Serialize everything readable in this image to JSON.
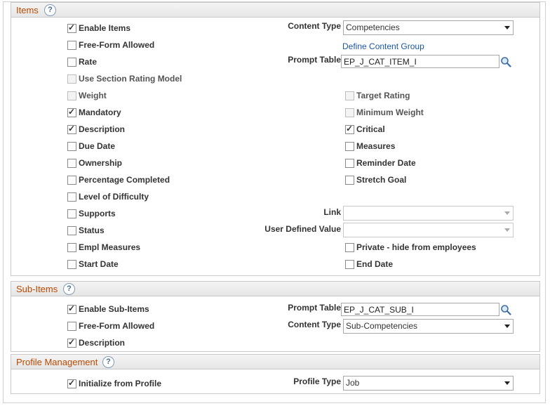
{
  "items": {
    "title": "Items",
    "help": "?",
    "left_checkboxes": [
      {
        "label": "Enable Items",
        "checked": true,
        "disabled": false
      },
      {
        "label": "Free-Form Allowed",
        "checked": false,
        "disabled": false
      },
      {
        "label": "Rate",
        "checked": false,
        "disabled": false
      },
      {
        "label": "Use Section Rating Model",
        "checked": false,
        "disabled": true
      },
      {
        "label": "Weight",
        "checked": false,
        "disabled": true
      },
      {
        "label": "Mandatory",
        "checked": true,
        "disabled": false
      },
      {
        "label": "Description",
        "checked": true,
        "disabled": false
      },
      {
        "label": "Due Date",
        "checked": false,
        "disabled": false
      },
      {
        "label": "Ownership",
        "checked": false,
        "disabled": false
      },
      {
        "label": "Percentage Completed",
        "checked": false,
        "disabled": false
      },
      {
        "label": "Level of Difficulty",
        "checked": false,
        "disabled": false
      },
      {
        "label": "Supports",
        "checked": false,
        "disabled": false
      },
      {
        "label": "Status",
        "checked": false,
        "disabled": false
      },
      {
        "label": "Empl Measures",
        "checked": false,
        "disabled": false
      },
      {
        "label": "Start Date",
        "checked": false,
        "disabled": false
      }
    ],
    "right_checkboxes": [
      {
        "label": "Target Rating",
        "checked": false,
        "disabled": true
      },
      {
        "label": "Minimum Weight",
        "checked": false,
        "disabled": true
      },
      {
        "label": "Critical",
        "checked": true,
        "disabled": false
      },
      {
        "label": "Measures",
        "checked": false,
        "disabled": false
      },
      {
        "label": "Reminder Date",
        "checked": false,
        "disabled": false
      },
      {
        "label": "Stretch Goal",
        "checked": false,
        "disabled": false
      },
      {
        "label": "Private - hide from employees",
        "checked": false,
        "disabled": false
      },
      {
        "label": "End Date",
        "checked": false,
        "disabled": false
      }
    ],
    "content_type_label": "Content Type",
    "content_type_value": "Competencies",
    "define_content_group_link": "Define Content Group",
    "prompt_table_label": "Prompt Table",
    "prompt_table_value": "EP_J_CAT_ITEM_I",
    "link_label": "Link",
    "link_value": "",
    "user_defined_value_label": "User Defined Value",
    "user_defined_value_value": ""
  },
  "sub_items": {
    "title": "Sub-Items",
    "help": "?",
    "checkboxes": [
      {
        "label": "Enable Sub-Items",
        "checked": true,
        "disabled": false
      },
      {
        "label": "Free-Form Allowed",
        "checked": false,
        "disabled": false
      },
      {
        "label": "Description",
        "checked": true,
        "disabled": false
      }
    ],
    "prompt_table_label": "Prompt Table",
    "prompt_table_value": "EP_J_CAT_SUB_I",
    "content_type_label": "Content Type",
    "content_type_value": "Sub-Competencies"
  },
  "profile_management": {
    "title": "Profile Management",
    "help": "?",
    "initialize_label": "Initialize from Profile",
    "initialize_checked": true,
    "profile_type_label": "Profile Type",
    "profile_type_value": "Job"
  },
  "colors": {
    "section_title": "#b84a00",
    "link": "#1c56a3"
  },
  "icons": {
    "lookup": "magnifier-icon",
    "help": "help-icon",
    "dropdown": "chevron-down-icon"
  }
}
